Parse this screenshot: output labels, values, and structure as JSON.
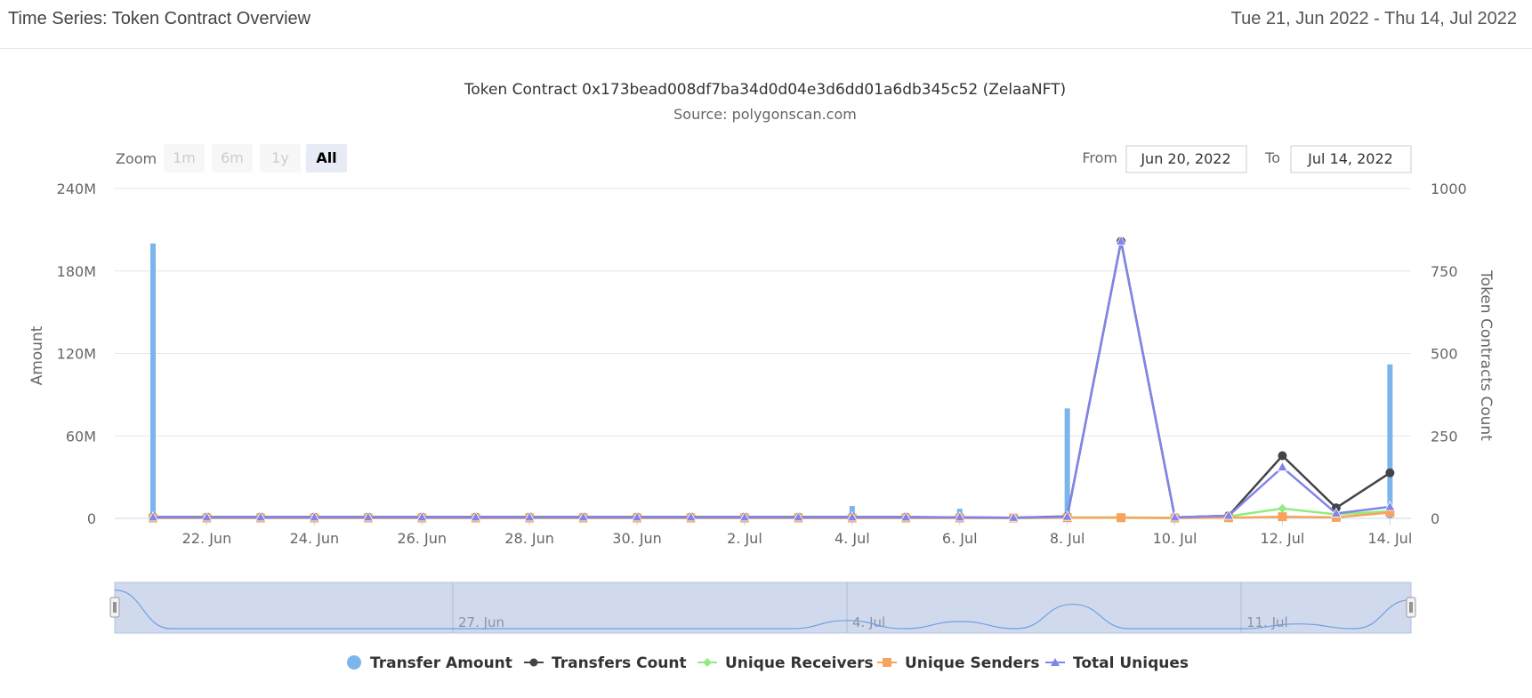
{
  "header": {
    "title": "Time Series: Token Contract Overview",
    "date_range": "Tue 21, Jun 2022 - Thu 14, Jul 2022"
  },
  "zoom": {
    "label": "Zoom",
    "buttons": [
      {
        "label": "1m",
        "state": "disabled"
      },
      {
        "label": "6m",
        "state": "disabled"
      },
      {
        "label": "1y",
        "state": "disabled"
      },
      {
        "label": "All",
        "state": "selected"
      }
    ]
  },
  "range_selector": {
    "from_label": "From",
    "from_value": "Jun 20, 2022",
    "to_label": "To",
    "to_value": "Jul 14, 2022"
  },
  "navigator": {
    "labels": [
      "27. Jun",
      "4. Jul",
      "11. Jul"
    ]
  },
  "chart_data": {
    "type": "bar",
    "title": "Token Contract 0x173bead008df7ba34d0d04e3d6dd01a6db345c52 (ZelaaNFT)",
    "subtitle": "Source: polygonscan.com",
    "x": [
      "2022-06-21",
      "2022-06-22",
      "2022-06-23",
      "2022-06-24",
      "2022-06-25",
      "2022-06-26",
      "2022-06-27",
      "2022-06-28",
      "2022-06-29",
      "2022-06-30",
      "2022-07-01",
      "2022-07-02",
      "2022-07-03",
      "2022-07-04",
      "2022-07-05",
      "2022-07-06",
      "2022-07-07",
      "2022-07-08",
      "2022-07-09",
      "2022-07-10",
      "2022-07-11",
      "2022-07-12",
      "2022-07-13",
      "2022-07-14"
    ],
    "x_tick_labels": [
      "22. Jun",
      "24. Jun",
      "26. Jun",
      "28. Jun",
      "30. Jun",
      "2. Jul",
      "4. Jul",
      "6. Jul",
      "8. Jul",
      "10. Jul",
      "12. Jul",
      "14. Jul"
    ],
    "y_left": {
      "label": "Amount",
      "ylim": [
        0,
        240000000
      ],
      "tick_labels": [
        "0",
        "60M",
        "120M",
        "180M",
        "240M"
      ]
    },
    "y_right": {
      "label": "Token Contracts Count",
      "ylim": [
        0,
        1000
      ],
      "tick_labels": [
        "0",
        "250",
        "500",
        "750",
        "1000"
      ]
    },
    "grid": true,
    "legend_position": "bottom",
    "series": [
      {
        "name": "Transfer Amount",
        "type": "column",
        "axis": "left",
        "color": "#7cb5ec",
        "values": [
          200000000,
          0,
          0,
          0,
          0,
          0,
          0,
          0,
          0,
          0,
          0,
          0,
          0,
          9000000,
          0,
          7000000,
          0,
          80000000,
          0,
          0,
          0,
          3000000,
          0,
          112000000
        ]
      },
      {
        "name": "Transfers Count",
        "type": "line",
        "axis": "right",
        "color": "#434348",
        "marker": "circle",
        "values": [
          4,
          4,
          4,
          4,
          4,
          4,
          4,
          4,
          4,
          4,
          4,
          4,
          4,
          4,
          4,
          3,
          2,
          6,
          840,
          3,
          8,
          190,
          32,
          138
        ]
      },
      {
        "name": "Unique Receivers",
        "type": "line",
        "axis": "right",
        "color": "#90ed7d",
        "marker": "diamond",
        "values": [
          2,
          2,
          2,
          2,
          2,
          2,
          2,
          2,
          2,
          2,
          2,
          2,
          2,
          2,
          2,
          2,
          1,
          3,
          3,
          2,
          6,
          30,
          12,
          22
        ]
      },
      {
        "name": "Unique Senders",
        "type": "line",
        "axis": "right",
        "color": "#f7a35c",
        "marker": "square",
        "values": [
          1,
          1,
          1,
          1,
          1,
          1,
          1,
          1,
          1,
          1,
          1,
          1,
          1,
          1,
          1,
          1,
          1,
          2,
          2,
          1,
          2,
          5,
          3,
          18
        ]
      },
      {
        "name": "Total Uniques",
        "type": "line",
        "axis": "right",
        "color": "#8085e9",
        "marker": "triangle",
        "values": [
          3,
          3,
          3,
          3,
          3,
          3,
          3,
          3,
          3,
          3,
          3,
          3,
          3,
          3,
          3,
          3,
          2,
          5,
          840,
          3,
          8,
          155,
          15,
          35
        ]
      }
    ]
  }
}
